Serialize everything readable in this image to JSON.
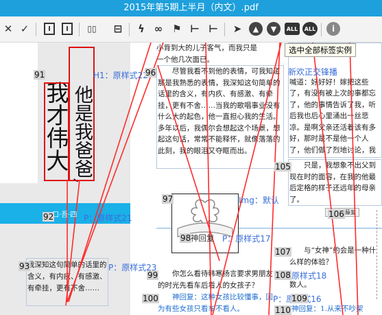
{
  "window": {
    "title": "2015年第5期上半月（内文）.pdf"
  },
  "toolbar": {
    "buttons": [
      {
        "name": "close-icon",
        "glyph": "✕"
      },
      {
        "name": "confirm-icon",
        "glyph": "✓"
      },
      {
        "name": "text-column-icon",
        "glyph": "I"
      },
      {
        "name": "text-column-alt-icon",
        "glyph": "I"
      },
      {
        "name": "split-columns-icon",
        "glyph": "▯▯"
      },
      {
        "name": "merge-rows-icon",
        "glyph": "⊟"
      },
      {
        "name": "lightning-tag-icon",
        "glyph": "ϟ"
      },
      {
        "name": "link-icon",
        "glyph": "∞"
      },
      {
        "name": "flag-icon",
        "glyph": "⚑"
      },
      {
        "name": "minus-level-icon",
        "glyph": "⊢"
      },
      {
        "name": "plus-level-icon",
        "glyph": "⊢"
      },
      {
        "name": "pointer-icon",
        "glyph": "➤"
      },
      {
        "name": "arrow-up-icon",
        "glyph": "▲"
      },
      {
        "name": "arrow-down-icon",
        "glyph": "▼"
      },
      {
        "name": "select-all-icon",
        "glyph": "ALL"
      },
      {
        "name": "select-all-circle-icon",
        "glyph": "ALL"
      },
      {
        "name": "info-icon",
        "glyph": "i"
      }
    ],
    "tooltip": "选中全部标签实例"
  },
  "left": {
    "big_text_col1": "我才伟大",
    "big_text_col2": "他是我爸爸,",
    "tag_91": "91",
    "tag_h1": "H1：原样式22",
    "tag_92": "92",
    "bluebar_text": "口·吾·四",
    "tag_p21": "P：原样式21",
    "tag_93": "93",
    "tag_p23": "P：原样式23",
    "small_para": "我深知这句简单的话里的含义，有内疚、有感激、有牵挂，更有不舍……"
  },
  "page": {
    "top_line": "小背到大的儿子客气，而我只是",
    "top_line2": "一个他几次面已。",
    "tag_96": "96",
    "para_96": "尽管我看不到他的表情，可我知道那是我熟悉的表情，我深知这句简单的话里的含义，有内疚、有感激、有牵挂，更有不舍……当我的歌唱事业没有什么大的起色，他一直担心我的生活。多年以后，我偶尔会想起这个场景，想起这句话，常常不能释怀，就像落落的此刻，我的眼泪又夺眶而出。",
    "right_top": "了，有没有被上次的事都忘了，他的事情告诉了我，听后我也后心里涌出一丝悲凉。是啊父亲还活着该有多好，那时是不是他一个人了，他们做了烈地讨论，我甚至可以想的内容。",
    "tag_right_blue": "新欢正交锋播",
    "right_frag": "喊道：好好好！嫁把这些",
    "tag_105": "105",
    "para_105": "只是，我想象不出父到现在时的面容，在我的他最后定格的样子还远年的母亲了。",
    "tag_97": "97",
    "tag_img": "Img：默认",
    "tag_106": "106",
    "stamp": "新钞稷藤复",
    "tag_98": "98",
    "tag_shenghui": "神回复",
    "tag_p17": "P：原样式17",
    "tag_107": "107",
    "para_107": "与“女神”约会是一种什么样的体验？",
    "tag_99": "99",
    "para_99": "你怎么看待韩寒扬言要求男朋友的时光先看车后看人的女孩子？",
    "tag_108": "108",
    "tag_style18": "原样式18",
    "para_108": "数人。",
    "tag_100": "100",
    "para_100": "神回复：这种女孩比较懂事，因为有些女孩只看车不看人。",
    "tag_p16": "P：原样式16",
    "tag_109": "109",
    "tag_110": "110",
    "para_110": "神回复：1.从来不吵架"
  },
  "colors": {
    "titlebar": "#1ea0dc",
    "tag_blue": "#3a6fd8",
    "annotation_red": "#e01010"
  }
}
